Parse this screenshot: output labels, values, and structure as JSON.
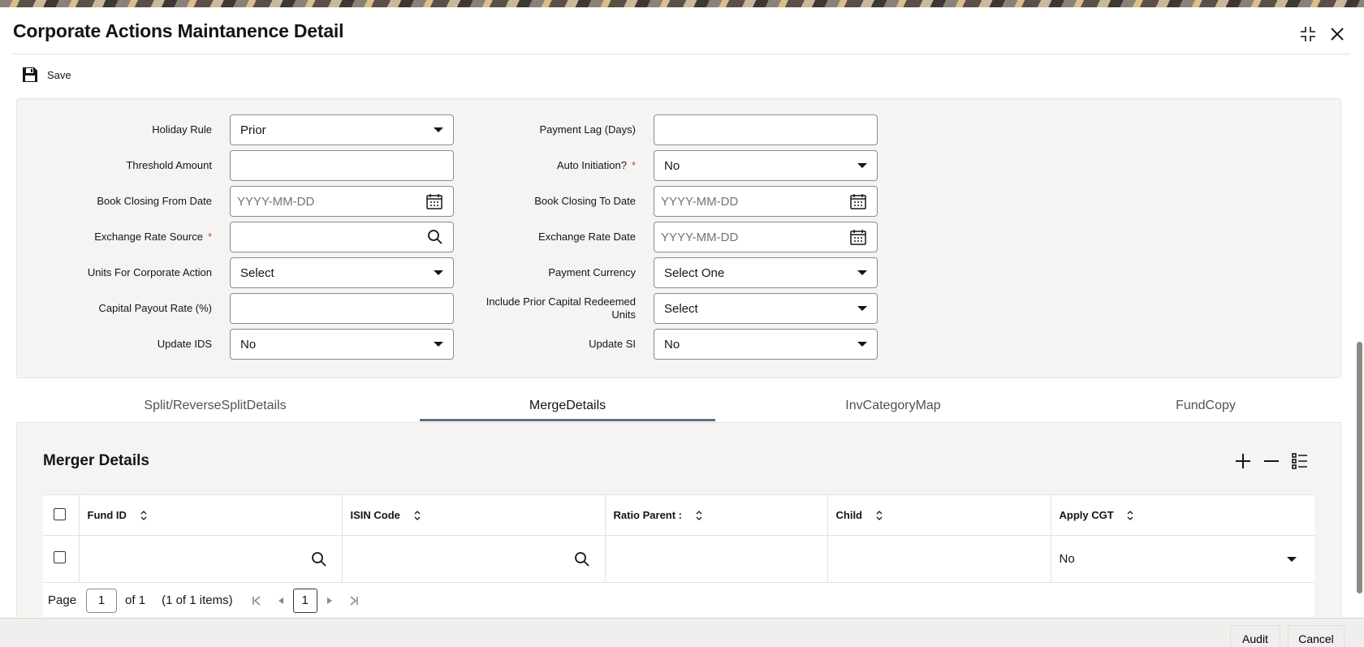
{
  "window": {
    "title": "Corporate Actions Maintanence Detail",
    "icons": [
      "collapse-icon",
      "close-icon"
    ]
  },
  "toolbar": {
    "save_label": "Save"
  },
  "form": {
    "holiday_rule": {
      "label": "Holiday Rule",
      "value": "Prior"
    },
    "payment_lag": {
      "label": "Payment Lag (Days)",
      "value": ""
    },
    "threshold_amount": {
      "label": "Threshold Amount",
      "value": ""
    },
    "auto_initiation": {
      "label": "Auto Initiation?",
      "required": "*",
      "value": "No"
    },
    "book_closing_from": {
      "label": "Book Closing From Date",
      "placeholder": "YYYY-MM-DD"
    },
    "book_closing_to": {
      "label": "Book Closing To Date",
      "placeholder": "YYYY-MM-DD"
    },
    "exchange_rate_source": {
      "label": "Exchange Rate Source",
      "required": "*",
      "value": ""
    },
    "exchange_rate_date": {
      "label": "Exchange Rate Date",
      "placeholder": "YYYY-MM-DD"
    },
    "units_for_corporate_action": {
      "label": "Units For Corporate Action",
      "value": "Select"
    },
    "payment_currency": {
      "label": "Payment Currency",
      "value": "Select One"
    },
    "capital_payout_rate": {
      "label": "Capital Payout Rate (%)",
      "value": ""
    },
    "include_prior_capital": {
      "label_line1": "Include Prior Capital Redeemed",
      "label_line2": "Units",
      "value": "Select"
    },
    "update_ids": {
      "label": "Update IDS",
      "value": "No"
    },
    "update_si": {
      "label": "Update SI",
      "value": "No"
    }
  },
  "tabs": [
    {
      "label": "Split/ReverseSplitDetails",
      "active": false
    },
    {
      "label": "MergeDetails",
      "active": true
    },
    {
      "label": "InvCategoryMap",
      "active": false
    },
    {
      "label": "FundCopy",
      "active": false
    }
  ],
  "merger": {
    "title": "Merger Details",
    "columns": [
      "Fund ID",
      "ISIN Code",
      "Ratio Parent :",
      "Child",
      "Apply CGT"
    ],
    "rows": [
      {
        "fund_id": "",
        "isin_code": "",
        "ratio_parent": "",
        "child": "",
        "apply_cgt": "No"
      }
    ],
    "pager": {
      "page_label": "Page",
      "page_value": "1",
      "of_label": "of 1",
      "items_label": "(1 of 1 items)",
      "current_page": "1"
    }
  },
  "footer": {
    "audit_label": "Audit",
    "cancel_label": "Cancel"
  }
}
